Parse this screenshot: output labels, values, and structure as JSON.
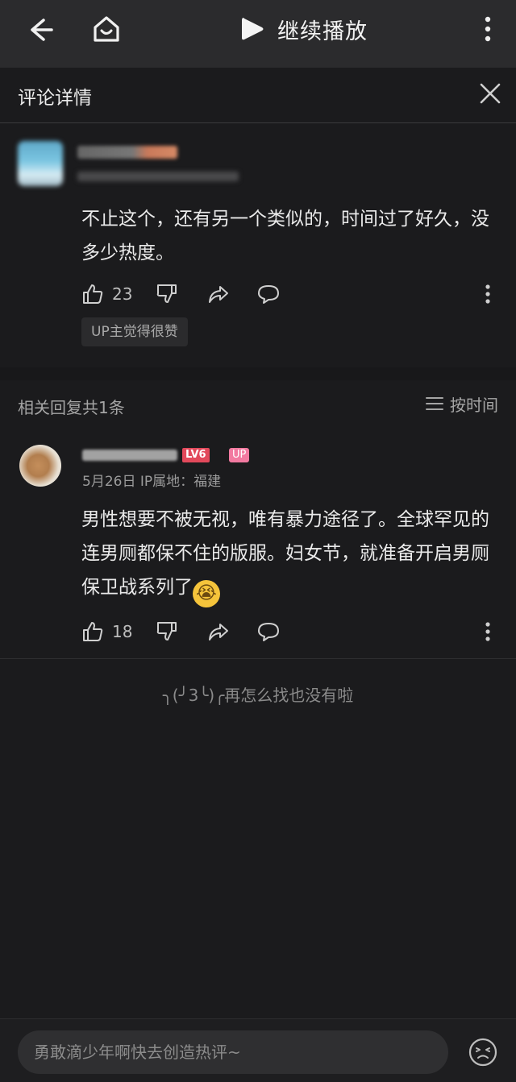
{
  "topbar": {
    "play_label": "继续播放"
  },
  "header": {
    "title": "评论详情"
  },
  "main_comment": {
    "text": "不止这个，还有另一个类似的，时间过了好久，没多少热度。",
    "likes": "23",
    "up_badge": "UP主觉得很赞"
  },
  "replies_section": {
    "count_label": "相关回复共1条",
    "sort_label": "按时间"
  },
  "reply": {
    "level_badge": "LV6",
    "up_tag": "UP",
    "meta": "5月26日 IP属地：福建",
    "text": "男性想要不被无视，唯有暴力途径了。全球罕见的连男厕都保不住的版服。妇女节，就准备开启男厕保卫战系列了",
    "emoji": "😭",
    "likes": "18"
  },
  "end_note": "╮(╯3╰)╭再怎么找也没有啦",
  "bottom": {
    "input_placeholder": "勇敢滴少年啊快去创造热评~"
  },
  "colors": {
    "background": "#18181a",
    "topbar": "#2b2b2d",
    "level_badge": "#e2495b",
    "up_tag": "#f27aa0"
  }
}
